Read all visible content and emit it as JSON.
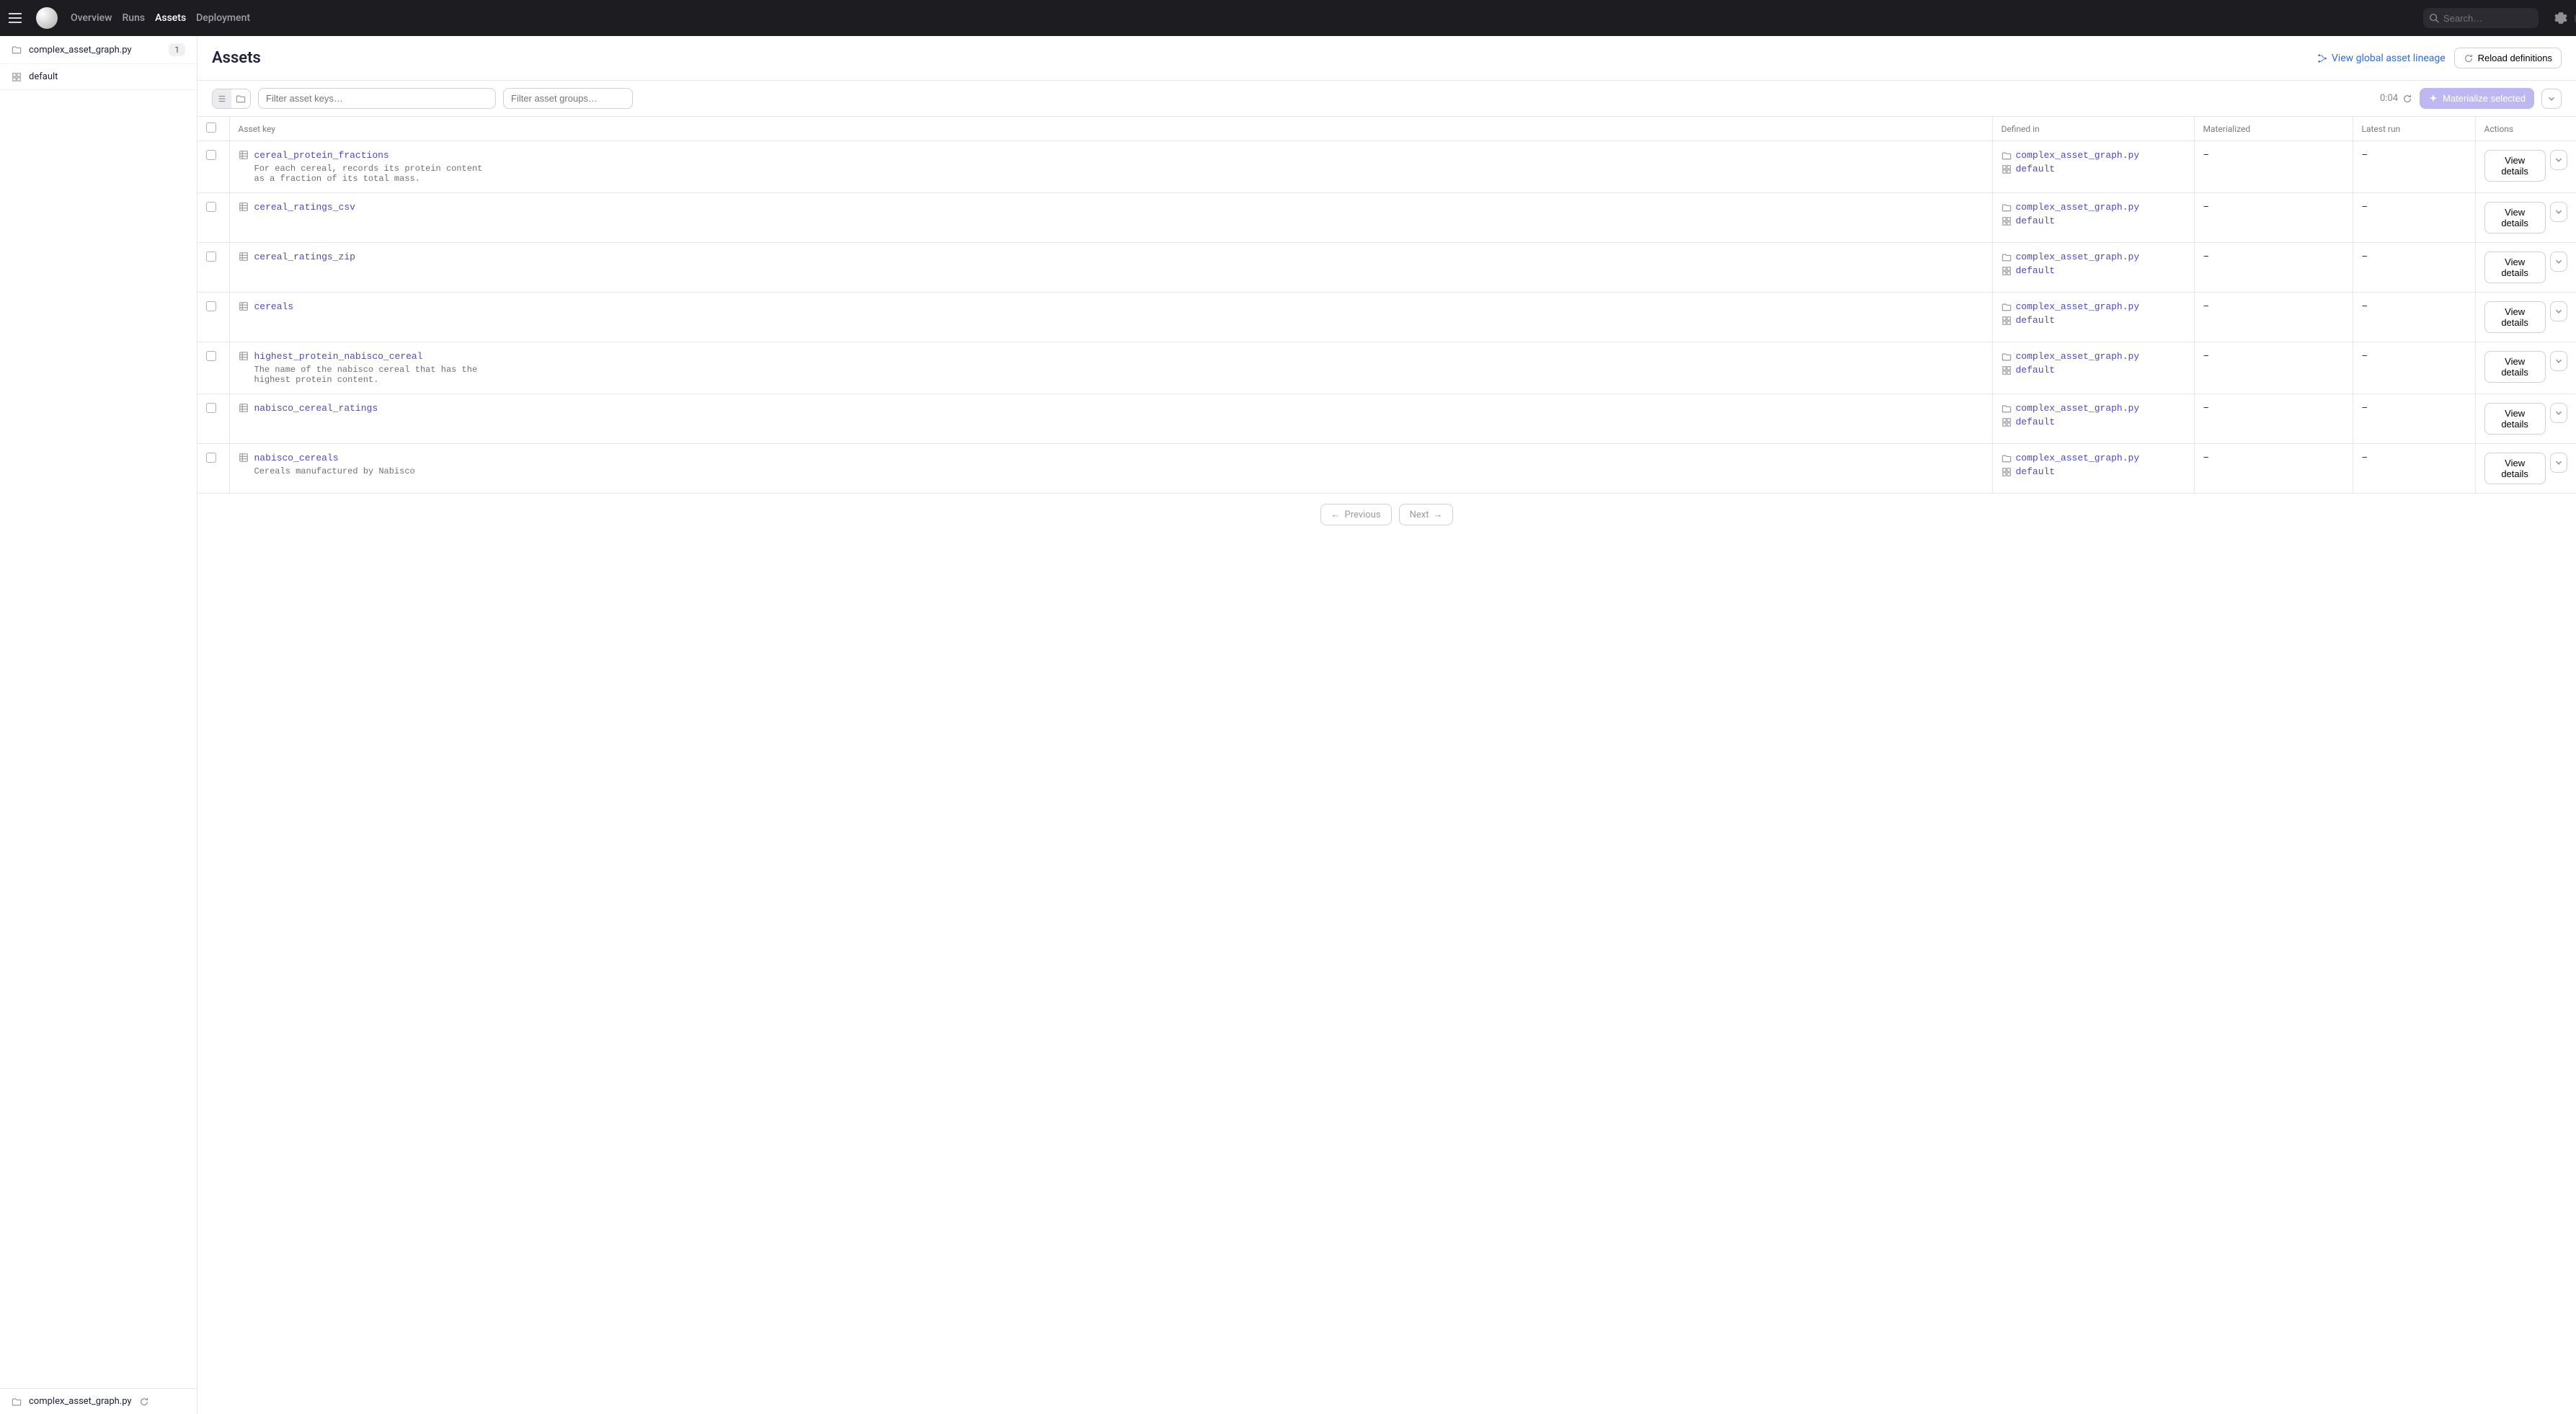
{
  "nav": {
    "items": [
      "Overview",
      "Runs",
      "Assets",
      "Deployment"
    ],
    "active": "Assets"
  },
  "search": {
    "placeholder": "Search…",
    "key": "/"
  },
  "sidebar": {
    "items": [
      {
        "icon": "folder",
        "label": "complex_asset_graph.py",
        "count": "1"
      },
      {
        "icon": "group",
        "label": "default"
      }
    ],
    "footer": {
      "label": "complex_asset_graph.py"
    }
  },
  "page": {
    "title": "Assets",
    "view_lineage": "View global asset lineage",
    "reload": "Reload definitions"
  },
  "toolbar": {
    "filter_keys_ph": "Filter asset keys…",
    "filter_groups_ph": "Filter asset groups…",
    "timer": "0:04",
    "materialize": "Materialize selected"
  },
  "columns": {
    "asset_key": "Asset key",
    "defined_in": "Defined in",
    "materialized": "Materialized",
    "latest_run": "Latest run",
    "actions": "Actions"
  },
  "defined_in": {
    "file": "complex_asset_graph.py",
    "group": "default"
  },
  "rows": [
    {
      "key": "cereal_protein_fractions",
      "desc": "For each cereal, records its protein content as a fraction of its total mass.",
      "materialized": "–",
      "latest_run": "–"
    },
    {
      "key": "cereal_ratings_csv",
      "desc": "",
      "materialized": "–",
      "latest_run": "–"
    },
    {
      "key": "cereal_ratings_zip",
      "desc": "",
      "materialized": "–",
      "latest_run": "–"
    },
    {
      "key": "cereals",
      "desc": "",
      "materialized": "–",
      "latest_run": "–"
    },
    {
      "key": "highest_protein_nabisco_cereal",
      "desc": "The name of the nabisco cereal that has the highest protein content.",
      "materialized": "–",
      "latest_run": "–"
    },
    {
      "key": "nabisco_cereal_ratings",
      "desc": "",
      "materialized": "–",
      "latest_run": "–"
    },
    {
      "key": "nabisco_cereals",
      "desc": "Cereals manufactured by Nabisco",
      "materialized": "–",
      "latest_run": "–"
    }
  ],
  "action_label": "View details",
  "pagination": {
    "prev": "Previous",
    "next": "Next"
  }
}
